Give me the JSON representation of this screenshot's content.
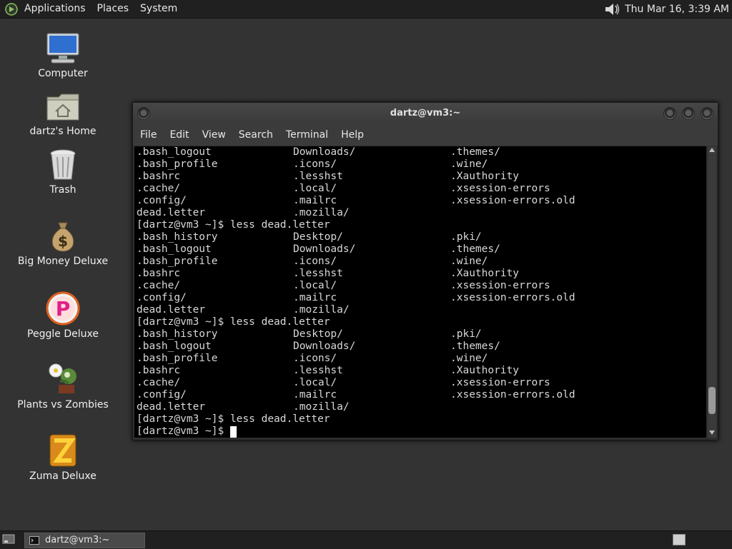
{
  "top_panel": {
    "menus": [
      "Applications",
      "Places",
      "System"
    ],
    "clock": "Thu Mar 16,  3:39 AM"
  },
  "desktop_icons": [
    {
      "label": "Computer",
      "icon": "computer-icon"
    },
    {
      "label": "dartz's Home",
      "icon": "home-folder-icon"
    },
    {
      "label": "Trash",
      "icon": "trash-icon"
    },
    {
      "label": "Big Money Deluxe",
      "icon": "money-bag-icon"
    },
    {
      "label": "Peggle Deluxe",
      "icon": "peggle-icon"
    },
    {
      "label": "Plants vs Zombies",
      "icon": "plants-vs-zombies-icon"
    },
    {
      "label": "Zuma Deluxe",
      "icon": "zuma-icon"
    }
  ],
  "terminal_window": {
    "title": "dartz@vm3:~",
    "menu": [
      "File",
      "Edit",
      "View",
      "Search",
      "Terminal",
      "Help"
    ],
    "scroll_position": 0.95,
    "scroll_thumb_fraction": 0.1,
    "lines": [
      [
        ".bash_logout",
        "Downloads/",
        ".themes/"
      ],
      [
        ".bash_profile",
        ".icons/",
        ".wine/"
      ],
      [
        ".bashrc",
        ".lesshst",
        ".Xauthority"
      ],
      [
        ".cache/",
        ".local/",
        ".xsession-errors"
      ],
      [
        ".config/",
        ".mailrc",
        ".xsession-errors.old"
      ],
      [
        "dead.letter",
        ".mozilla/",
        ""
      ],
      [
        "[dartz@vm3 ~]$ less dead.letter",
        "",
        ""
      ],
      [
        ".bash_history",
        "Desktop/",
        ".pki/"
      ],
      [
        ".bash_logout",
        "Downloads/",
        ".themes/"
      ],
      [
        ".bash_profile",
        ".icons/",
        ".wine/"
      ],
      [
        ".bashrc",
        ".lesshst",
        ".Xauthority"
      ],
      [
        ".cache/",
        ".local/",
        ".xsession-errors"
      ],
      [
        ".config/",
        ".mailrc",
        ".xsession-errors.old"
      ],
      [
        "dead.letter",
        ".mozilla/",
        ""
      ],
      [
        "[dartz@vm3 ~]$ less dead.letter",
        "",
        ""
      ],
      [
        ".bash_history",
        "Desktop/",
        ".pki/"
      ],
      [
        ".bash_logout",
        "Downloads/",
        ".themes/"
      ],
      [
        ".bash_profile",
        ".icons/",
        ".wine/"
      ],
      [
        ".bashrc",
        ".lesshst",
        ".Xauthority"
      ],
      [
        ".cache/",
        ".local/",
        ".xsession-errors"
      ],
      [
        ".config/",
        ".mailrc",
        ".xsession-errors.old"
      ],
      [
        "dead.letter",
        ".mozilla/",
        ""
      ],
      [
        "[dartz@vm3 ~]$ less dead.letter",
        "",
        ""
      ]
    ],
    "prompt": "[dartz@vm3 ~]$ "
  },
  "bottom_panel": {
    "task_label": "dartz@vm3:~"
  }
}
